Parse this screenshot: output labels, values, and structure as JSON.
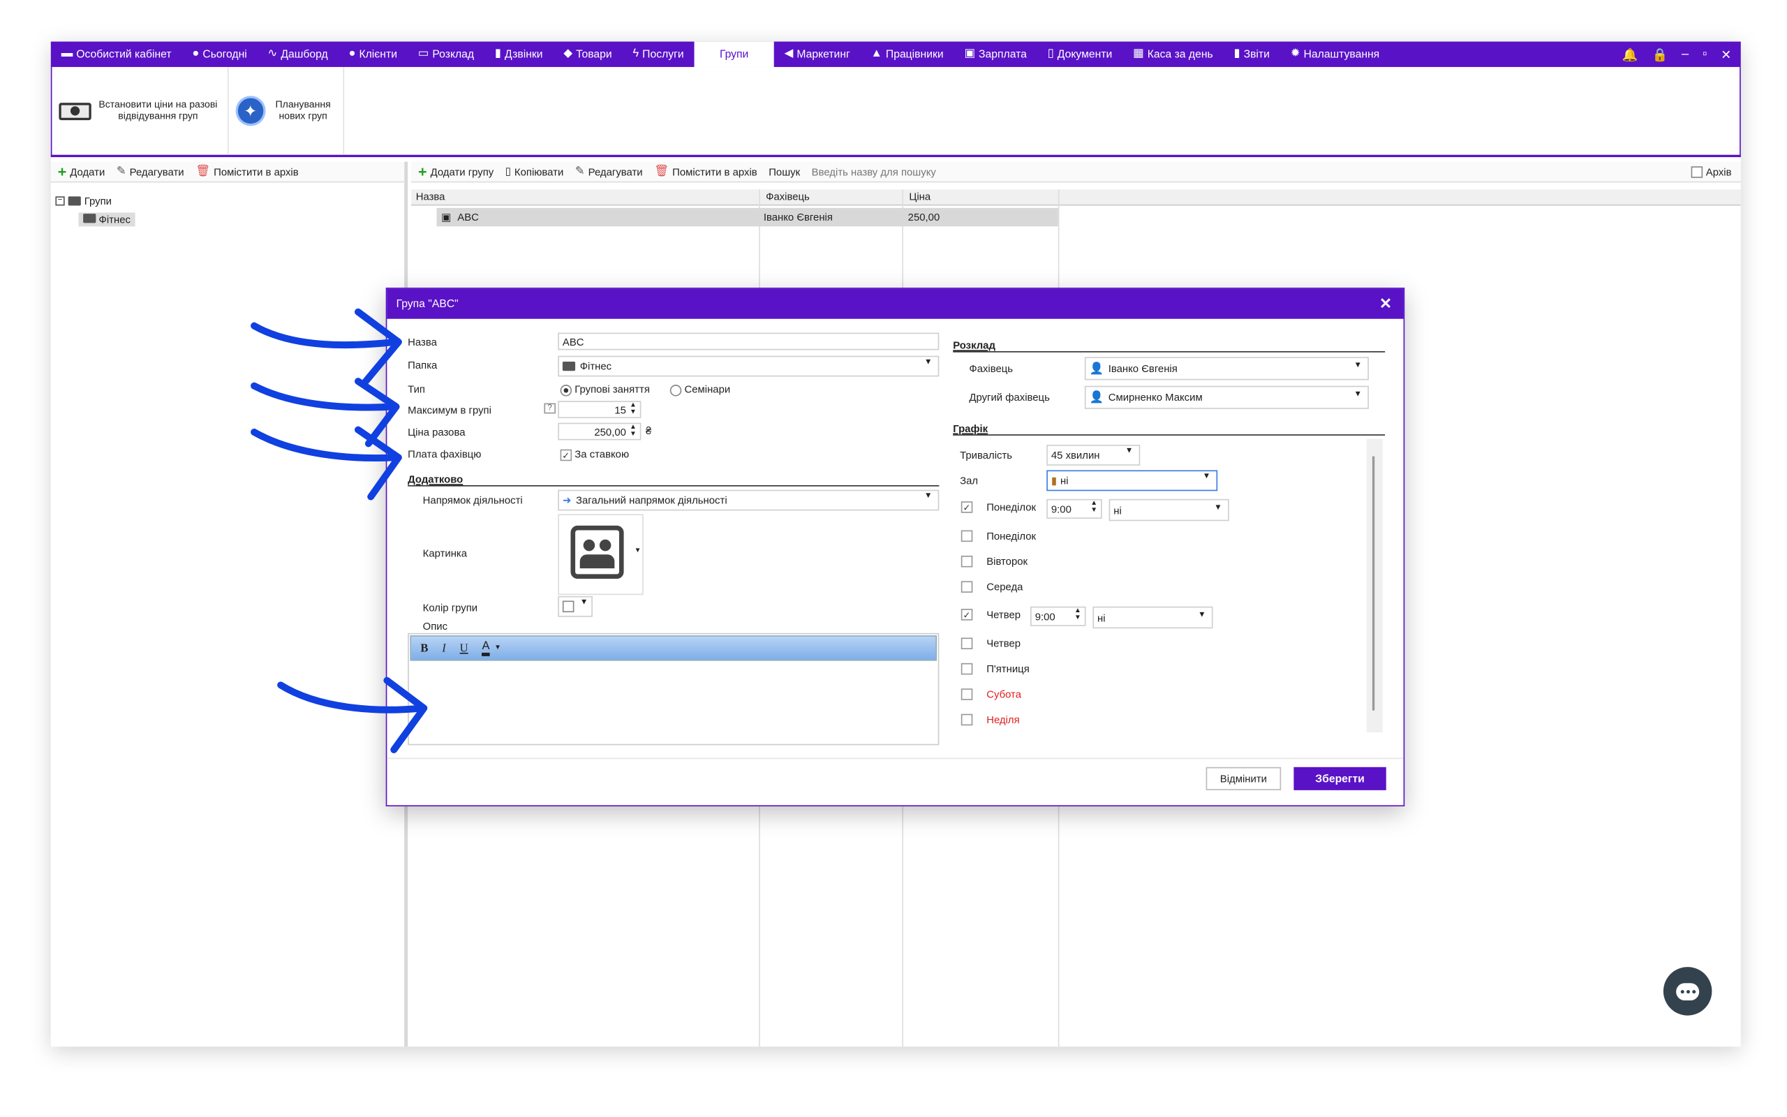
{
  "nav": {
    "items": [
      {
        "icon": "wallet-icon",
        "glyph": "▬",
        "label": "Особистий кабінет"
      },
      {
        "icon": "clock-icon",
        "glyph": "●",
        "label": "Сьогодні"
      },
      {
        "icon": "pulse-icon",
        "glyph": "∿",
        "label": "Дашборд"
      },
      {
        "icon": "user-circle-icon",
        "glyph": "●",
        "label": "Клієнти"
      },
      {
        "icon": "calendar-icon",
        "glyph": "▭",
        "label": "Розклад"
      },
      {
        "icon": "phone-icon",
        "glyph": "▮",
        "label": "Дзвінки"
      },
      {
        "icon": "box-icon",
        "glyph": "◆",
        "label": "Товари"
      },
      {
        "icon": "lightning-icon",
        "glyph": "ϟ",
        "label": "Послуги"
      },
      {
        "icon": "",
        "glyph": "",
        "label": "Групи"
      },
      {
        "icon": "megaphone-icon",
        "glyph": "◀",
        "label": "Маркетинг"
      },
      {
        "icon": "person-icon",
        "glyph": "▲",
        "label": "Працівники"
      },
      {
        "icon": "money-icon",
        "glyph": "▣",
        "label": "Зарплата"
      },
      {
        "icon": "document-icon",
        "glyph": "▯",
        "label": "Документи"
      },
      {
        "icon": "calculator-icon",
        "glyph": "▦",
        "label": "Каса за день"
      },
      {
        "icon": "bar-chart-icon",
        "glyph": "▮",
        "label": "Звіти"
      },
      {
        "icon": "gear-icon",
        "glyph": "✹",
        "label": "Налаштування"
      }
    ],
    "active": "Групи"
  },
  "ribbon": {
    "set_prices": "Встановити ціни на разові відвідування груп",
    "plan_groups": "Планування нових груп"
  },
  "left_toolbar": {
    "add": "Додати",
    "edit": "Редагувати",
    "archive": "Помістити в архів"
  },
  "tree": {
    "root": "Групи",
    "child": "Фітнес"
  },
  "right_toolbar": {
    "add_group": "Додати групу",
    "copy": "Копіювати",
    "edit": "Редагувати",
    "archive": "Помістити в архів",
    "search_label": "Пошук",
    "search_placeholder": "Введіть назву для пошуку",
    "archive_check": "Архів"
  },
  "grid": {
    "columns": [
      "Назва",
      "Фахівець",
      "Ціна"
    ],
    "rows": [
      {
        "name": "ABC",
        "specialist": "Іванко Євгенія",
        "price": "250,00"
      }
    ]
  },
  "dialog": {
    "title": "Група \"ABC\"",
    "labels": {
      "name": "Назва",
      "folder": "Папка",
      "type": "Тип",
      "max": "Максимум в групі",
      "price": "Ціна разова",
      "payment": "Плата фахівцю",
      "additional": "Додатково",
      "direction": "Напрямок діяльності",
      "picture": "Картинка",
      "color": "Колір групи",
      "description": "Опис"
    },
    "values": {
      "name": "ABC",
      "folder": "Фітнес",
      "type_group": "Групові заняття",
      "type_seminar": "Семінари",
      "max": "15",
      "price": "250,00",
      "currency": "₴",
      "payment_check": "За ставкою",
      "direction": "Загальний напрямок діяльності",
      "help": "?"
    },
    "schedule": {
      "section": "Розклад",
      "specialist_label": "Фахівець",
      "specialist": "Іванко Євгенія",
      "second_label": "Другий фахівець",
      "second": "Смирненко Максим"
    },
    "graph": {
      "section": "Графік",
      "duration_label": "Тривалість",
      "duration": "45 хвилин",
      "hall_label": "Зал",
      "hall": "ні",
      "days": [
        {
          "label": "Понеділок",
          "checked": true,
          "time": "9:00",
          "hall": "ні",
          "weekend": false
        },
        {
          "label": "Понеділок",
          "checked": false,
          "weekend": false
        },
        {
          "label": "Вівторок",
          "checked": false,
          "weekend": false
        },
        {
          "label": "Середа",
          "checked": false,
          "weekend": false
        },
        {
          "label": "Четвер",
          "checked": true,
          "time": "9:00",
          "hall": "ні",
          "weekend": false
        },
        {
          "label": "Четвер",
          "checked": false,
          "weekend": false
        },
        {
          "label": "П'ятниця",
          "checked": false,
          "weekend": false
        },
        {
          "label": "Субота",
          "checked": false,
          "weekend": true
        },
        {
          "label": "Неділя",
          "checked": false,
          "weekend": true
        }
      ]
    },
    "rte": {
      "bold": "B",
      "italic": "I",
      "underline": "U",
      "color": "A"
    },
    "cancel": "Відмінити",
    "save": "Зберегти"
  },
  "colors": {
    "accent": "#5a12c6",
    "weekend": "#e02020",
    "arrow": "#1040e0"
  }
}
